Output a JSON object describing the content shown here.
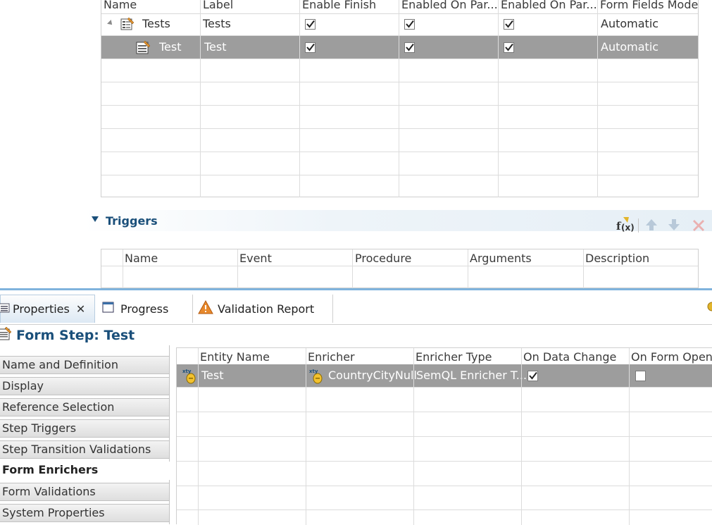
{
  "steps_table": {
    "columns": [
      "Name",
      "Label",
      "Enable Finish",
      "Enabled On Par...",
      "Enabled On Par...",
      "Form Fields Mode"
    ],
    "rows": [
      {
        "name": "Tests",
        "label": "Tests",
        "enable_finish": true,
        "enabled_on_par_1": true,
        "enabled_on_par_2": true,
        "form_fields_mode": "Automatic",
        "selected": false
      },
      {
        "name": "Test",
        "label": "Test",
        "enable_finish": true,
        "enabled_on_par_1": true,
        "enabled_on_par_2": true,
        "form_fields_mode": "Automatic",
        "selected": true
      }
    ]
  },
  "triggers": {
    "title": "Triggers",
    "columns": [
      "Name",
      "Event",
      "Procedure",
      "Arguments",
      "Description"
    ],
    "toolbar_icons": [
      "function-icon",
      "move-up-icon",
      "move-down-icon",
      "delete-icon"
    ]
  },
  "tabs": [
    {
      "label": "Properties",
      "icon": "properties-icon",
      "active": true,
      "closable": true
    },
    {
      "label": "Progress",
      "icon": "progress-icon",
      "active": false
    },
    {
      "label": "Validation Report",
      "icon": "warning-icon",
      "active": false
    }
  ],
  "form_step": {
    "title": "Form Step: Test"
  },
  "sidenav": {
    "items": [
      {
        "label": "Name and Definition",
        "selected": false
      },
      {
        "label": "Display",
        "selected": false
      },
      {
        "label": "Reference Selection",
        "selected": false
      },
      {
        "label": "Step Triggers",
        "selected": false
      },
      {
        "label": "Step Transition Validations",
        "selected": false
      },
      {
        "label": "Form Enrichers",
        "selected": true
      },
      {
        "label": "Form Validations",
        "selected": false
      },
      {
        "label": "System Properties",
        "selected": false
      }
    ]
  },
  "enrichers_table": {
    "columns": [
      "Entity Name",
      "Enricher",
      "Enricher Type",
      "On Data Change",
      "On Form Open"
    ],
    "rows": [
      {
        "entity_name": "Test",
        "enricher": "CountryCityNull",
        "enricher_type": "SemQL Enricher T...",
        "on_data_change": true,
        "on_form_open": false,
        "selected": true
      }
    ]
  },
  "colors": {
    "accent": "#1a4f7a",
    "selection": "#9d9d9d",
    "tab_divider": "#7fb3dd"
  }
}
